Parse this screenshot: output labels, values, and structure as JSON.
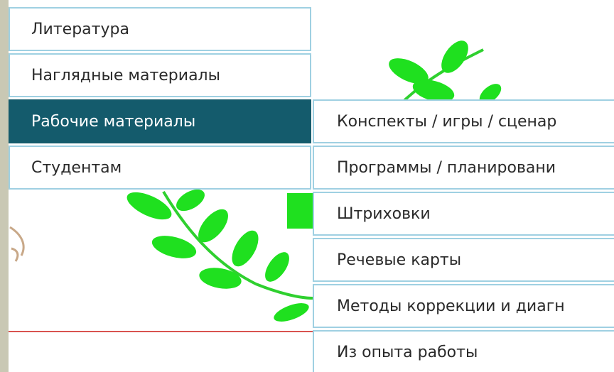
{
  "menu": {
    "items": [
      {
        "label": "Литература"
      },
      {
        "label": "Наглядные материалы"
      },
      {
        "label": "Рабочие материалы"
      },
      {
        "label": "Студентам"
      }
    ],
    "active_index": 2
  },
  "submenu": {
    "items": [
      {
        "label": "Конспекты / игры / сценар"
      },
      {
        "label": "Программы / планировани"
      },
      {
        "label": "Штриховки"
      },
      {
        "label": "Речевые карты"
      },
      {
        "label": "Методы коррекции и диагн"
      },
      {
        "label": "Из опыта работы"
      }
    ]
  },
  "colors": {
    "active_bg": "#145b6c",
    "border": "#9fd0e2",
    "leaf_green": "#1fe01f",
    "left_strip": "#c9c8b4"
  },
  "decorations": {
    "background_icon": "leaf-branch-icon"
  }
}
